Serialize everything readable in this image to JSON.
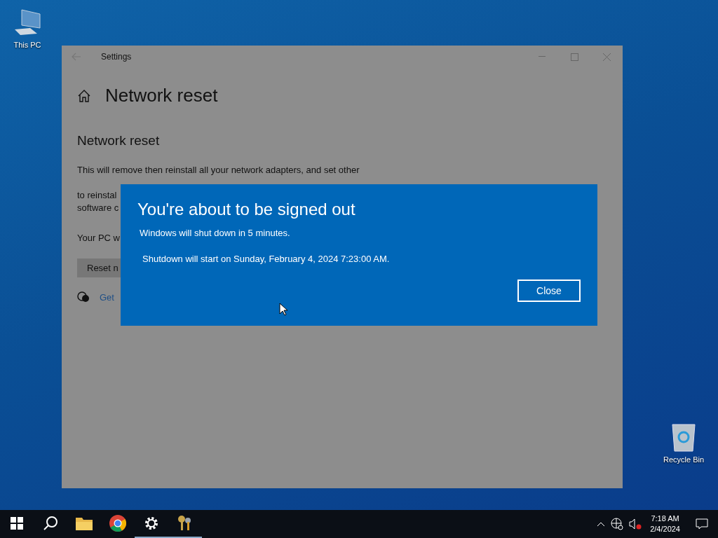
{
  "desktop_icons": [
    {
      "label": "This PC",
      "kind": "computer"
    },
    {
      "label": "Recycle Bin",
      "kind": "bin"
    }
  ],
  "settings_window": {
    "title": "Settings",
    "page_title": "Network reset",
    "section_title": "Network reset",
    "paragraph_lines": [
      "This will remove then reinstall all your network adapters, and set other",
      "to reinstal",
      "software c"
    ],
    "status_text": "Your PC w",
    "reset_button": "Reset n",
    "help_link": "Get"
  },
  "dialog": {
    "title": "You're about to be signed out",
    "message": "Windows will shut down in 5 minutes.",
    "detail": "Shutdown will start on Sunday, February 4, 2024 7:23:00 AM.",
    "button": "Close"
  },
  "taskbar": {
    "items": [
      {
        "kind": "start",
        "running": false
      },
      {
        "kind": "search",
        "running": false
      },
      {
        "kind": "folder",
        "running": false
      },
      {
        "kind": "browser",
        "running": false
      },
      {
        "kind": "settings",
        "running": true
      },
      {
        "kind": "keys",
        "running": true
      }
    ],
    "clock": {
      "time": "7:18 AM",
      "date": "2/4/2024"
    }
  }
}
